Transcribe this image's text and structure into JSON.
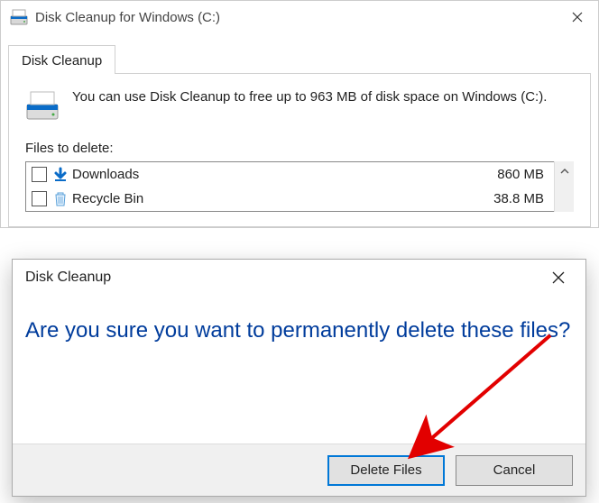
{
  "window": {
    "title": "Disk Cleanup for Windows (C:)"
  },
  "tabs": {
    "main": "Disk Cleanup"
  },
  "summary": "You can use Disk Cleanup to free up to 963 MB of disk space on Windows (C:).",
  "sections": {
    "files_to_delete": "Files to delete:"
  },
  "file_list": [
    {
      "label": "Downloads",
      "size": "860 MB",
      "checked": false,
      "icon": "download-arrow"
    },
    {
      "label": "Recycle Bin",
      "size": "38.8 MB",
      "checked": false,
      "icon": "recycle-bin"
    }
  ],
  "dialog": {
    "title": "Disk Cleanup",
    "message": "Are you sure you want to permanently delete these files?",
    "buttons": {
      "confirm": "Delete Files",
      "cancel": "Cancel"
    }
  }
}
